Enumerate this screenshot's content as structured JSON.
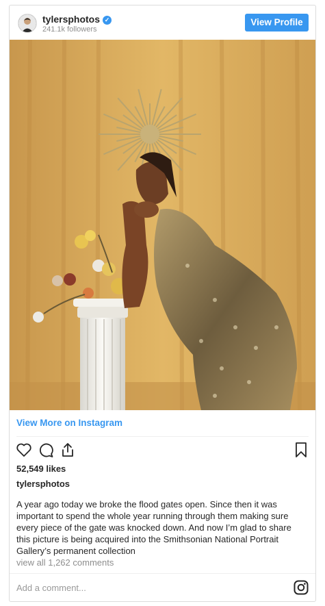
{
  "header": {
    "username": "tylersphotos",
    "followers": "241.1k followers",
    "view_profile_label": "View Profile",
    "verified_glyph": "✓"
  },
  "photo": {
    "description_icon": "photo",
    "colors": {
      "backdrop": "#d7a95c",
      "column": "#f2f0ea",
      "dress": "#8a7650"
    }
  },
  "links": {
    "view_more_label": "View More on Instagram"
  },
  "actions": {
    "like_icon": "heart-icon",
    "comment_icon": "comment-icon",
    "share_icon": "share-icon",
    "save_icon": "bookmark-icon"
  },
  "post": {
    "likes": "52,549 likes",
    "owner": "tylersphotos",
    "caption": "A year ago today we broke the flood gates open. Since then it was important to spend the whole year running through them making sure every piece of the gate was knocked down. And now I’m glad to share this picture is being acquired into the Smithsonian National Portrait Gallery’s permanent collection",
    "view_comments": "view all 1,262 comments"
  },
  "comment_box": {
    "placeholder": "Add a comment..."
  },
  "accent": "#3897f0"
}
